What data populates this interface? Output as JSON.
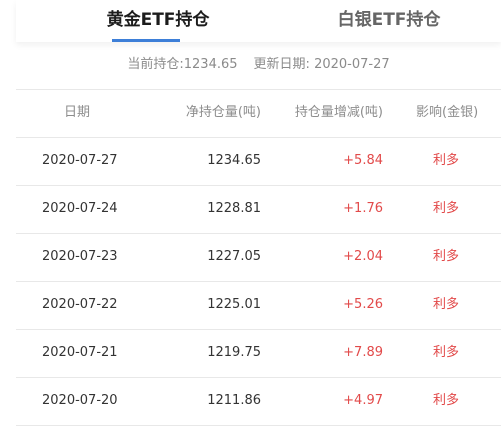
{
  "tabs": {
    "gold": "黄金ETF持仓",
    "silver": "白银ETF持仓"
  },
  "summary": {
    "current_label": "当前持仓:",
    "current_value": "1234.65",
    "update_label": "更新日期:",
    "update_value": "2020-07-27"
  },
  "table": {
    "headers": {
      "date": "日期",
      "holding": "净持仓量(吨)",
      "change": "持仓量增减(吨)",
      "effect": "影响(金银)"
    },
    "rows": [
      {
        "date": "2020-07-27",
        "holding": "1234.65",
        "change": "+5.84",
        "effect": "利多"
      },
      {
        "date": "2020-07-24",
        "holding": "1228.81",
        "change": "+1.76",
        "effect": "利多"
      },
      {
        "date": "2020-07-23",
        "holding": "1227.05",
        "change": "+2.04",
        "effect": "利多"
      },
      {
        "date": "2020-07-22",
        "holding": "1225.01",
        "change": "+5.26",
        "effect": "利多"
      },
      {
        "date": "2020-07-21",
        "holding": "1219.75",
        "change": "+7.89",
        "effect": "利多"
      },
      {
        "date": "2020-07-20",
        "holding": "1211.86",
        "change": "+4.97",
        "effect": "利多"
      }
    ]
  },
  "colors": {
    "accent": "#3d7fd8",
    "positive": "#e24a4a",
    "muted_text": "#8b8b8b"
  }
}
